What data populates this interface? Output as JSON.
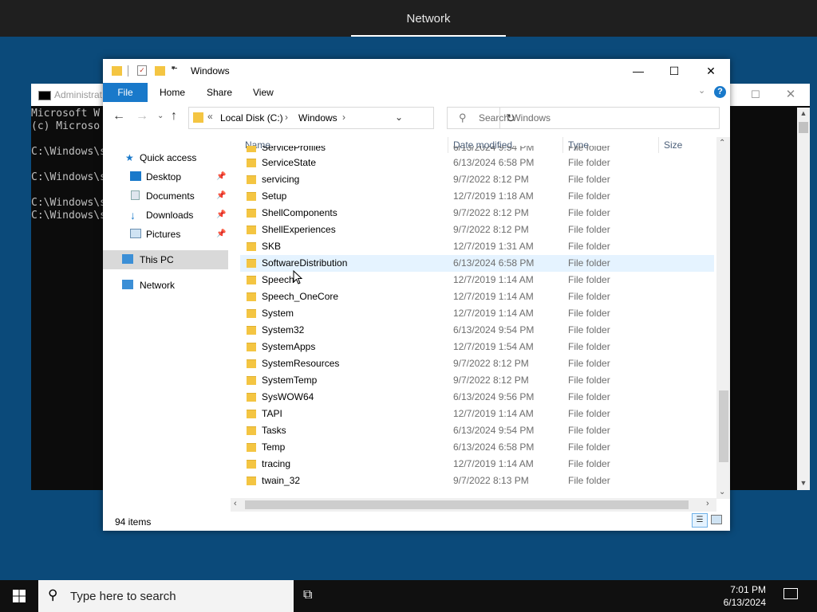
{
  "topbar": {
    "title": "Network"
  },
  "console": {
    "title": "Administrat",
    "lines": [
      "Microsoft W",
      "(c) Microso",
      "",
      "C:\\Windows\\s",
      "",
      "C:\\Windows\\s",
      "",
      "C:\\Windows\\s",
      "C:\\Windows\\s"
    ],
    "restore_glyph": "☐",
    "close_glyph": "✕"
  },
  "explorer": {
    "title": "Windows",
    "caption": {
      "minimize": "—",
      "maximize": "☐",
      "close": "✕"
    },
    "ribbon": {
      "file": "File",
      "home": "Home",
      "share": "Share",
      "view": "View",
      "help": "?"
    },
    "address": {
      "chevron": "«",
      "crumbs": [
        "Local Disk (C:)",
        "Windows"
      ],
      "sep": "›"
    },
    "search": {
      "placeholder": "Search Windows"
    },
    "nav": {
      "quick_access": "Quick access",
      "desktop": "Desktop",
      "documents": "Documents",
      "downloads": "Downloads",
      "pictures": "Pictures",
      "this_pc": "This PC",
      "network": "Network"
    },
    "columns": {
      "name": "Name",
      "date": "Date modified",
      "type": "Type",
      "size": "Size"
    },
    "partial_row": {
      "name": "ServiceProfiles",
      "date": "6/13/2024 9:54 PM",
      "type": "File folder"
    },
    "rows": [
      {
        "name": "ServiceState",
        "date": "6/13/2024 6:58 PM",
        "type": "File folder"
      },
      {
        "name": "servicing",
        "date": "9/7/2022 8:12 PM",
        "type": "File folder"
      },
      {
        "name": "Setup",
        "date": "12/7/2019 1:18 AM",
        "type": "File folder"
      },
      {
        "name": "ShellComponents",
        "date": "9/7/2022 8:12 PM",
        "type": "File folder"
      },
      {
        "name": "ShellExperiences",
        "date": "9/7/2022 8:12 PM",
        "type": "File folder"
      },
      {
        "name": "SKB",
        "date": "12/7/2019 1:31 AM",
        "type": "File folder"
      },
      {
        "name": "SoftwareDistribution",
        "date": "6/13/2024 6:58 PM",
        "type": "File folder"
      },
      {
        "name": "Speech",
        "date": "12/7/2019 1:14 AM",
        "type": "File folder"
      },
      {
        "name": "Speech_OneCore",
        "date": "12/7/2019 1:14 AM",
        "type": "File folder"
      },
      {
        "name": "System",
        "date": "12/7/2019 1:14 AM",
        "type": "File folder"
      },
      {
        "name": "System32",
        "date": "6/13/2024 9:54 PM",
        "type": "File folder"
      },
      {
        "name": "SystemApps",
        "date": "12/7/2019 1:54 AM",
        "type": "File folder"
      },
      {
        "name": "SystemResources",
        "date": "9/7/2022 8:12 PM",
        "type": "File folder"
      },
      {
        "name": "SystemTemp",
        "date": "9/7/2022 8:12 PM",
        "type": "File folder"
      },
      {
        "name": "SysWOW64",
        "date": "6/13/2024 9:56 PM",
        "type": "File folder"
      },
      {
        "name": "TAPI",
        "date": "12/7/2019 1:14 AM",
        "type": "File folder"
      },
      {
        "name": "Tasks",
        "date": "6/13/2024 9:54 PM",
        "type": "File folder"
      },
      {
        "name": "Temp",
        "date": "6/13/2024 6:58 PM",
        "type": "File folder"
      },
      {
        "name": "tracing",
        "date": "12/7/2019 1:14 AM",
        "type": "File folder"
      },
      {
        "name": "twain_32",
        "date": "9/7/2022 8:13 PM",
        "type": "File folder"
      }
    ],
    "status": {
      "count": "94 items"
    }
  },
  "taskbar": {
    "search_placeholder": "Type here to search",
    "time": "7:01 PM",
    "date": "6/13/2024"
  },
  "colors": {
    "accent": "#1979ca",
    "desktop": "#0b4a7a",
    "folder": "#f4c542",
    "selected_row": "#e5f3ff"
  }
}
